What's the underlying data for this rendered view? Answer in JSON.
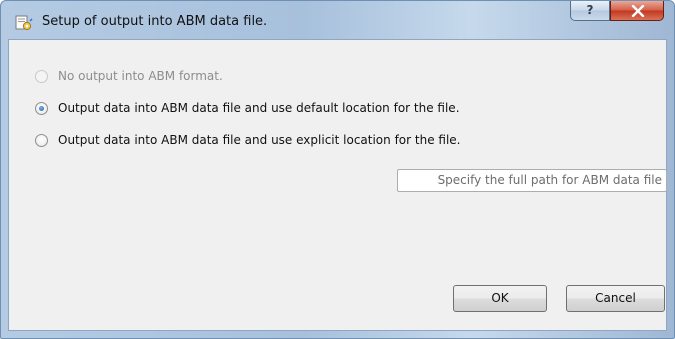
{
  "window": {
    "title": "Setup of output into ABM data file.",
    "help_label": "?",
    "icons": {
      "app": "settings-document-icon",
      "close": "close-icon"
    }
  },
  "options": [
    {
      "label": "No output into ABM format.",
      "checked": false,
      "enabled": false
    },
    {
      "label": "Output data into ABM data file and use default location for the file.",
      "checked": true,
      "enabled": true
    },
    {
      "label": "Output data into ABM data file and use explicit location for the file.",
      "checked": false,
      "enabled": true
    }
  ],
  "path_field": {
    "placeholder": "Specify the full path for ABM data file",
    "value": ""
  },
  "buttons": {
    "ok_label": "OK",
    "cancel_label": "Cancel"
  }
}
